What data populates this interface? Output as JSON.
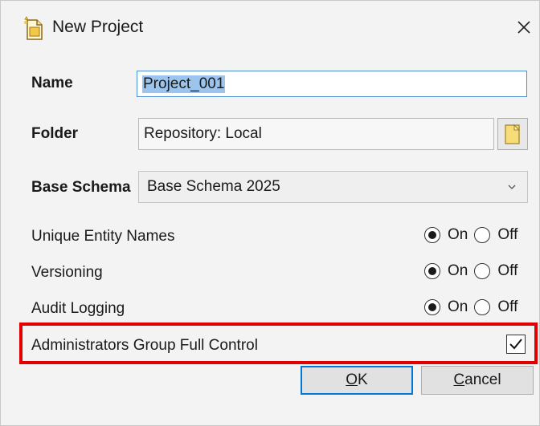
{
  "window": {
    "title": "New Project",
    "icon": "new-project-icon",
    "close_icon": "close-icon"
  },
  "form": {
    "name": {
      "label": "Name",
      "value": "Project_001",
      "selected": true
    },
    "folder": {
      "label": "Folder",
      "value": "Repository: Local",
      "browse_icon": "folder-browse-icon"
    },
    "base_schema": {
      "label": "Base Schema",
      "value": "Base Schema 2025",
      "dropdown_icon": "chevron-down-icon"
    },
    "options": [
      {
        "label": "Unique Entity Names",
        "on_label": "On",
        "off_label": "Off",
        "value": "On"
      },
      {
        "label": "Versioning",
        "on_label": "On",
        "off_label": "Off",
        "value": "On"
      },
      {
        "label": "Audit Logging",
        "on_label": "On",
        "off_label": "Off",
        "value": "On"
      }
    ],
    "admin_full_control": {
      "label": "Administrators Group Full Control",
      "checked": true
    }
  },
  "buttons": {
    "ok": {
      "accel": "O",
      "rest": "K"
    },
    "cancel": {
      "accel": "C",
      "rest": "ancel"
    }
  },
  "colors": {
    "highlight": "#e00000",
    "focus_border": "#0078d7",
    "selection": "#9cc5ee"
  }
}
